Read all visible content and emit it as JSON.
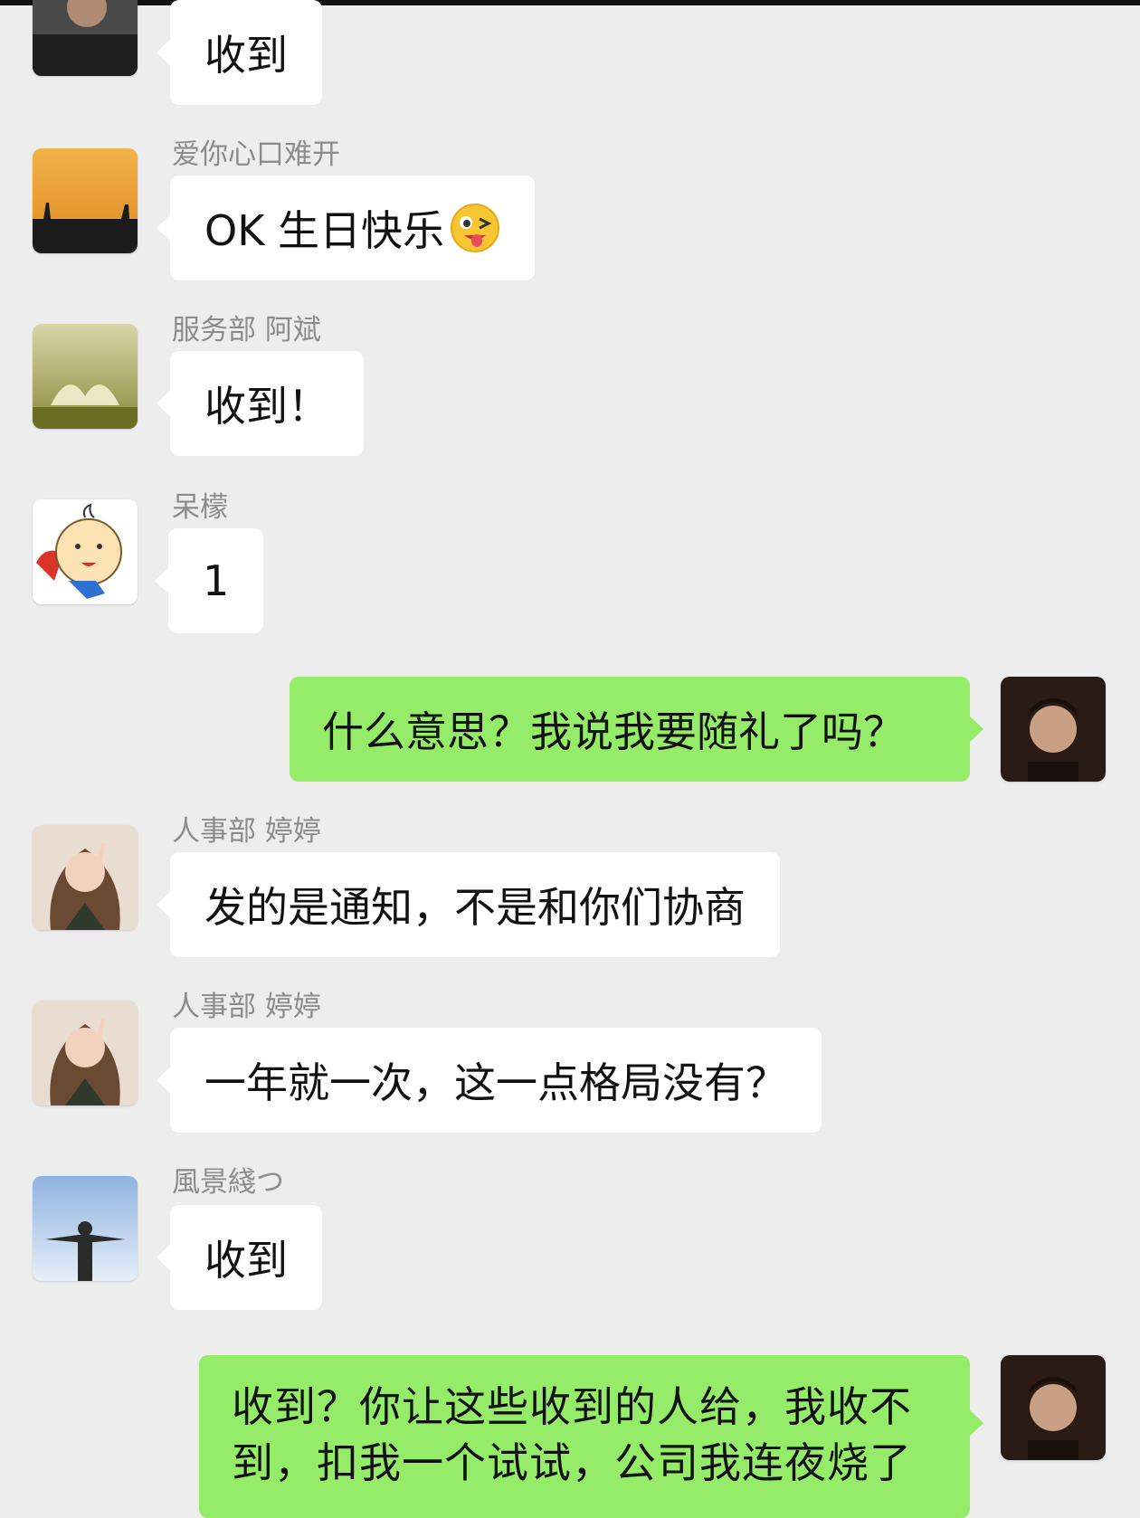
{
  "colors": {
    "background": "#ededed",
    "incoming_bubble": "#ffffff",
    "outgoing_bubble": "#95ec69",
    "sender_name": "#8c8c8c"
  },
  "messages": [
    {
      "direction": "in",
      "sender": "",
      "text": "收到",
      "avatar": "avatar-man-dark-shirt"
    },
    {
      "direction": "in",
      "sender": "爱你心口难开",
      "text": "OK 生日快乐",
      "emoji": "winking-tongue-emoji",
      "avatar": "avatar-sunset-silhouettes"
    },
    {
      "direction": "in",
      "sender": "服务部 阿斌",
      "text": "收到！",
      "avatar": "avatar-book-landscape"
    },
    {
      "direction": "in",
      "sender": "呆檬",
      "text": "1",
      "avatar": "avatar-cartoon-superboy"
    },
    {
      "direction": "out",
      "sender": "",
      "text": "什么意思？我说我要随礼了吗？",
      "avatar": "avatar-self-portrait"
    },
    {
      "direction": "in",
      "sender": "人事部 婷婷",
      "text": "发的是通知，不是和你们协商",
      "avatar": "avatar-woman-peace-sign"
    },
    {
      "direction": "in",
      "sender": "人事部 婷婷",
      "text": "一年就一次，这一点格局没有？",
      "avatar": "avatar-woman-peace-sign"
    },
    {
      "direction": "in",
      "sender": "風景綫つ",
      "text": "收到",
      "avatar": "avatar-man-open-arms-sky"
    },
    {
      "direction": "out",
      "sender": "",
      "text": "收到？你让这些收到的人给，我收不到，扣我一个试试，公司我连夜烧了",
      "avatar": "avatar-self-portrait"
    }
  ]
}
